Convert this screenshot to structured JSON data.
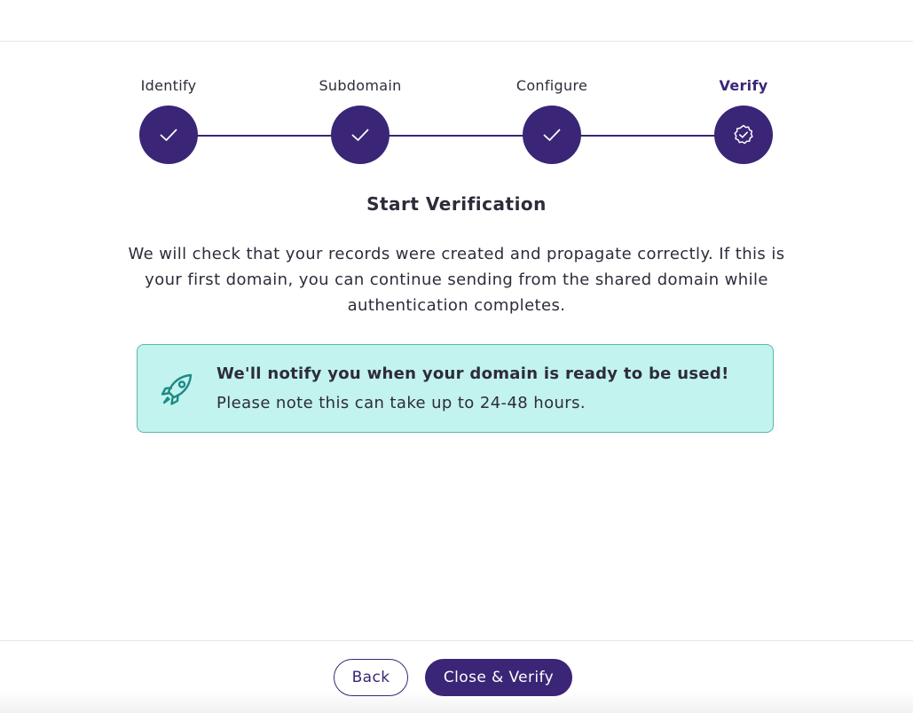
{
  "stepper": {
    "steps": [
      {
        "label": "Identify",
        "status": "complete",
        "icon": "check-icon"
      },
      {
        "label": "Subdomain",
        "status": "complete",
        "icon": "check-icon"
      },
      {
        "label": "Configure",
        "status": "complete",
        "icon": "check-icon"
      },
      {
        "label": "Verify",
        "status": "active",
        "icon": "verified-badge-icon"
      }
    ]
  },
  "content": {
    "heading": "Start Verification",
    "description": "We will check that your records were created and propagate correctly. If this is your first domain, you can continue sending from the shared domain while authentication completes."
  },
  "notice": {
    "icon": "rocket-icon",
    "title": "We'll notify you when your domain is ready to be used!",
    "body": "Please note this can take up to 24-48 hours."
  },
  "footer": {
    "back_label": "Back",
    "primary_label": "Close & Verify"
  },
  "colors": {
    "primary": "#3b2576",
    "notice_background": "#c2f3ee",
    "notice_border": "#5bb7ad",
    "notice_icon": "#1e8a85",
    "text": "#2f2b3a"
  }
}
